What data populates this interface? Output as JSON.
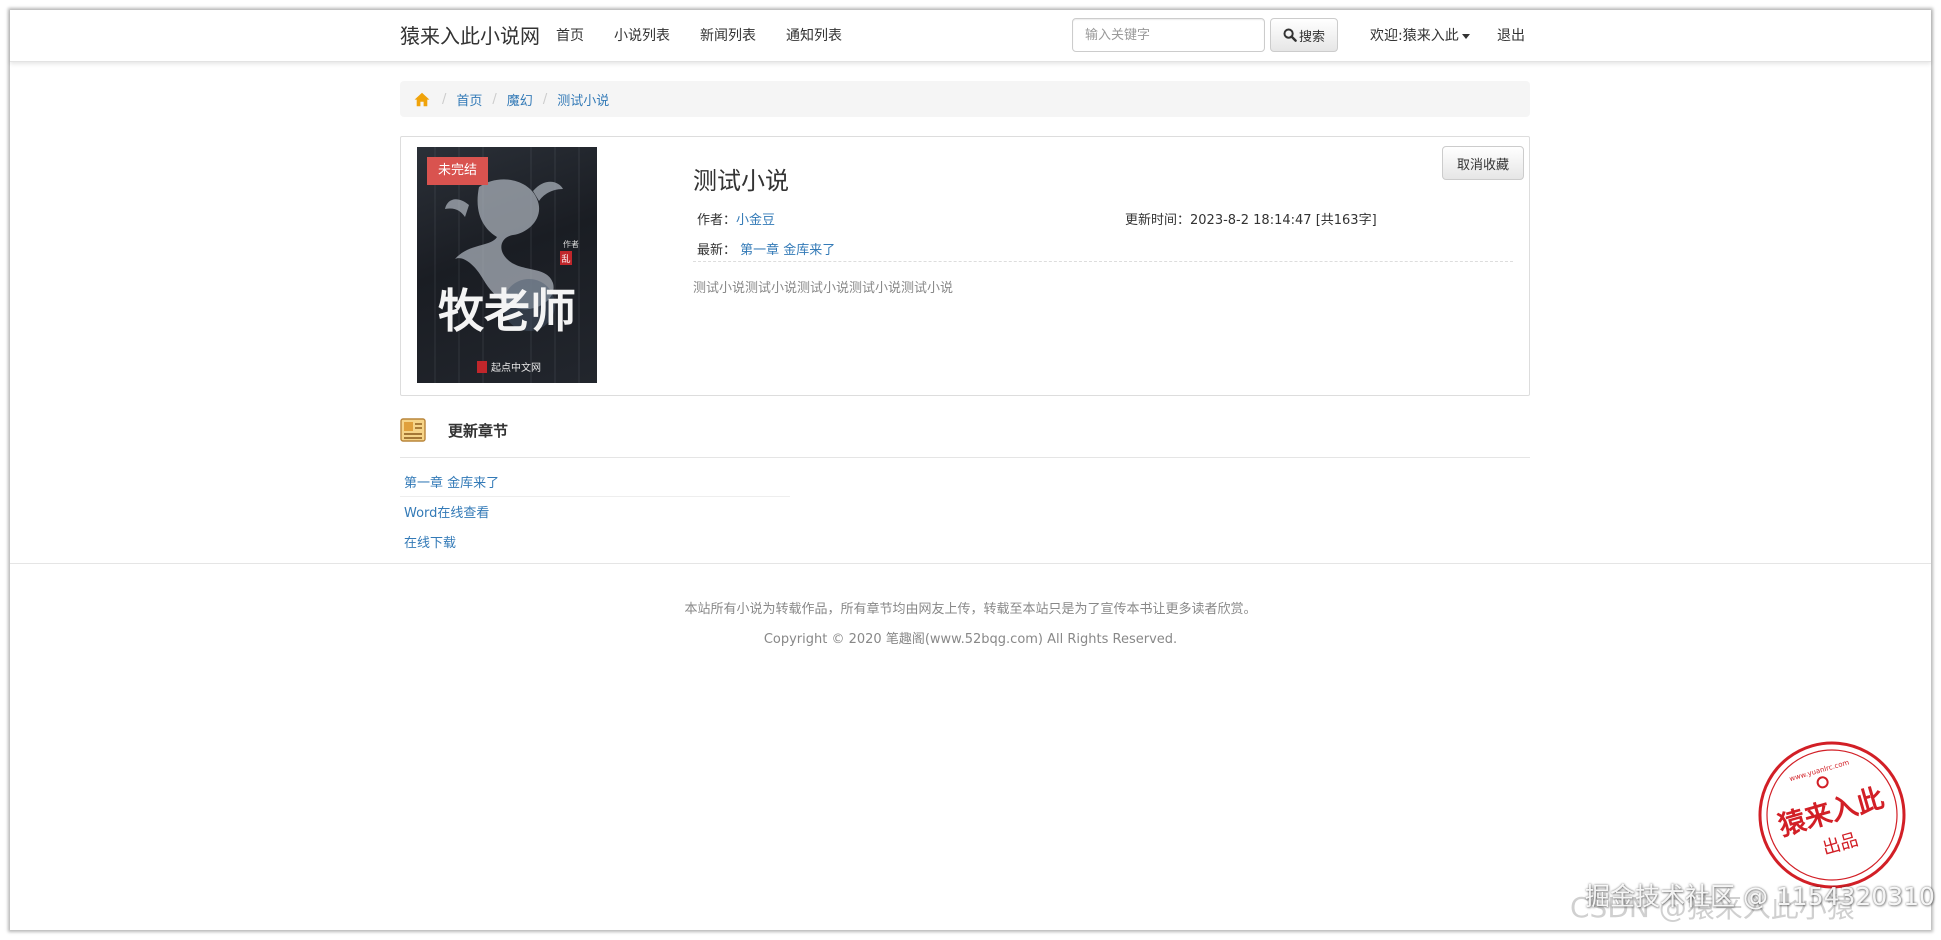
{
  "navbar": {
    "brand": "猿来入此小说网",
    "links": [
      "首页",
      "小说列表",
      "新闻列表",
      "通知列表"
    ],
    "search_placeholder": "输入关键字",
    "search_label": "搜索",
    "welcome": "欢迎:猿来入此",
    "logout": "退出"
  },
  "breadcrumb": {
    "icon": "home-icon",
    "items": [
      "首页",
      "魔幻",
      "测试小说"
    ]
  },
  "book": {
    "status": "未完结",
    "cover_title": "牧老师",
    "cover_author_label": "作者",
    "cover_author_mark": "乱",
    "cover_publisher": "起点中文网",
    "title": "测试小说",
    "author_label": "作者：",
    "author": "小金豆",
    "update_label": "更新时间：",
    "update_time": "2023-8-2 18:14:47",
    "word_count": "[共163字]",
    "latest_label": "最新：",
    "latest_chapter": "第一章 金库来了",
    "description": "测试小说测试小说测试小说测试小说测试小说",
    "unfavorite": "取消收藏"
  },
  "chapters": {
    "title": "更新章节",
    "icon": "book-list-icon",
    "items": [
      "第一章 金库来了",
      "Word在线查看",
      "在线下载"
    ]
  },
  "footer": {
    "notice": "本站所有小说为转载作品，所有章节均由网友上传，转载至本站只是为了宣传本书让更多读者欣赏。",
    "copyright": "Copyright © 2020 笔趣阁(www.52bqg.com) All Rights Reserved."
  },
  "stamp": {
    "main": "猿来入此",
    "sub": "出品",
    "url": "www.yuanlrc.com"
  },
  "watermark": {
    "text": "掘金技术社区 @ 1154320310",
    "ghost": "CSDN @猿来入此小猿"
  },
  "colors": {
    "link": "#337ab7",
    "status_tag": "#d9534f",
    "stamp_red": "#d21f26"
  }
}
